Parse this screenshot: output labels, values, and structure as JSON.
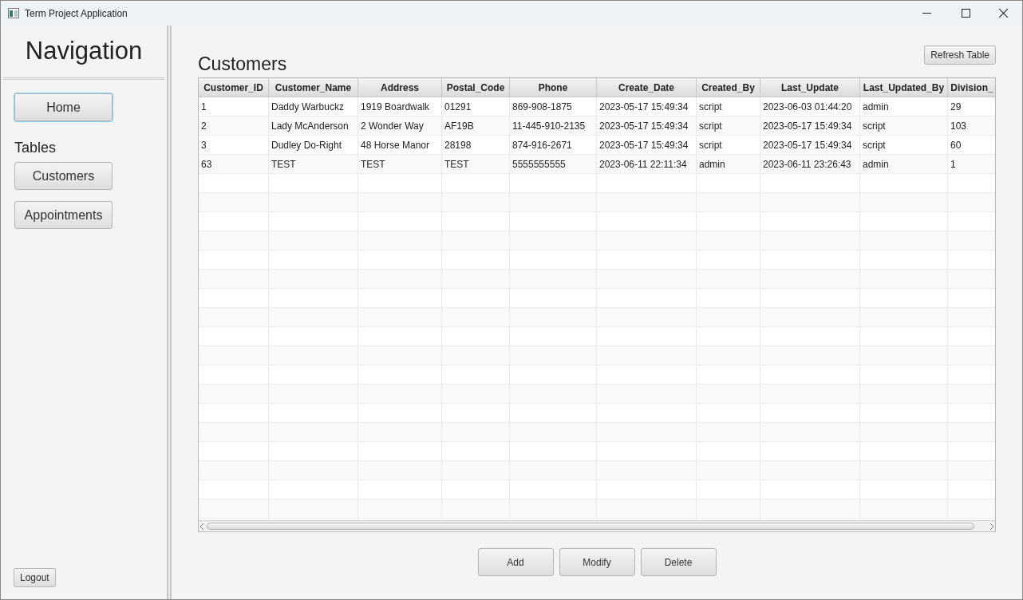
{
  "window": {
    "title": "Term Project Application"
  },
  "sidebar": {
    "title": "Navigation",
    "items": [
      {
        "kind": "button",
        "label": "Home",
        "selected": true
      },
      {
        "kind": "heading",
        "label": "Tables"
      },
      {
        "kind": "button",
        "label": "Customers",
        "selected": false
      },
      {
        "kind": "button",
        "label": "Appointments",
        "selected": false
      }
    ],
    "logout": "Logout"
  },
  "main": {
    "title": "Customers",
    "refresh": "Refresh Table"
  },
  "table": {
    "columns": [
      "Customer_ID",
      "Customer_Name",
      "Address",
      "Postal_Code",
      "Phone",
      "Create_Date",
      "Created_By",
      "Last_Update",
      "Last_Updated_By",
      "Division_"
    ],
    "rows": [
      [
        "1",
        "Daddy Warbuckz",
        "1919 Boardwalk",
        "01291",
        "869-908-1875",
        "2023-05-17 15:49:34",
        "script",
        "2023-06-03 01:44:20",
        "admin",
        "29"
      ],
      [
        "2",
        "Lady McAnderson",
        "2 Wonder Way",
        "AF19B",
        "11-445-910-2135",
        "2023-05-17 15:49:34",
        "script",
        "2023-05-17 15:49:34",
        "script",
        "103"
      ],
      [
        "3",
        "Dudley Do-Right",
        "48 Horse Manor",
        "28198",
        "874-916-2671",
        "2023-05-17 15:49:34",
        "script",
        "2023-05-17 15:49:34",
        "script",
        "60"
      ],
      [
        "63",
        "TEST",
        "TEST",
        "TEST",
        "5555555555",
        "2023-06-11 22:11:34",
        "admin",
        "2023-06-11 23:26:43",
        "admin",
        "1"
      ]
    ]
  },
  "buttons": [
    "Add",
    "Modify",
    "Delete"
  ]
}
